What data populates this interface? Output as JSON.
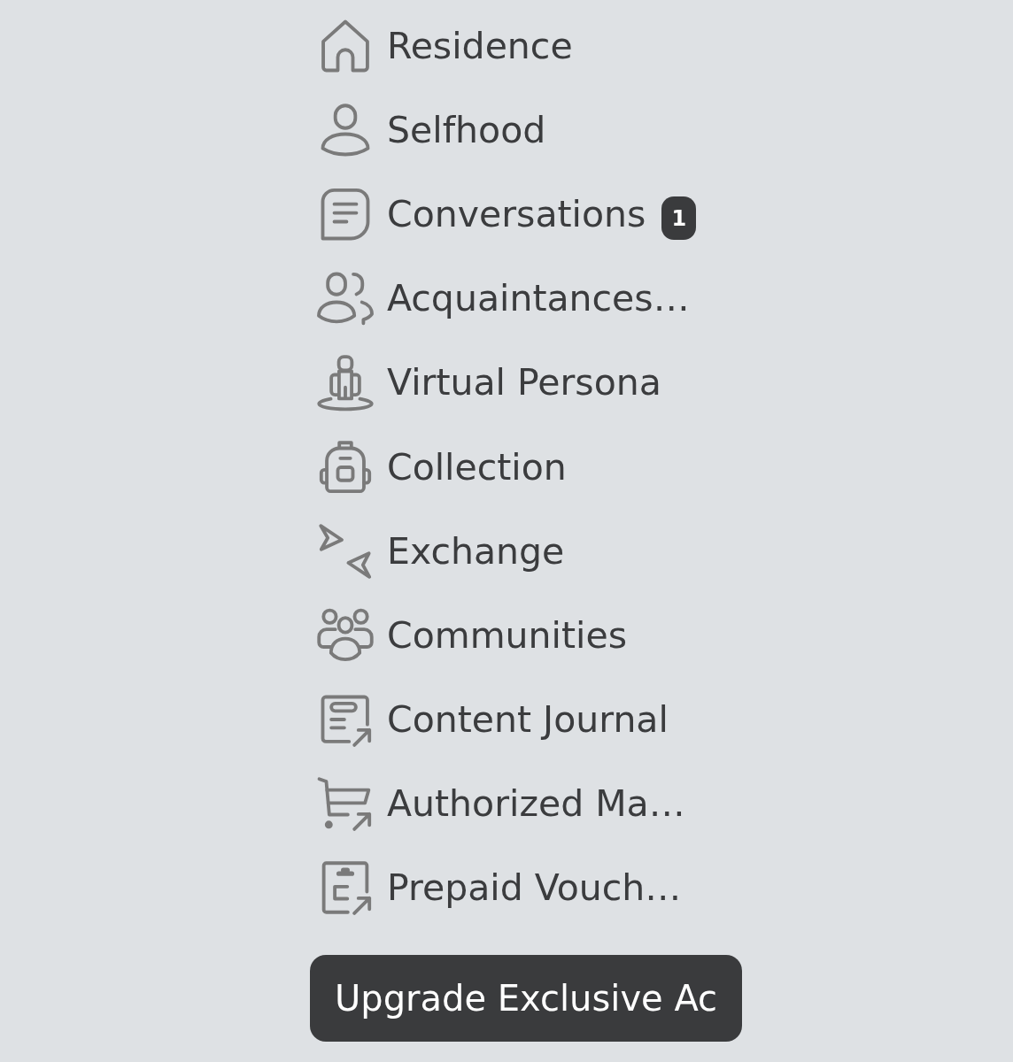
{
  "sidebar": {
    "items": [
      {
        "label": "Residence",
        "selected": false
      },
      {
        "label": "Selfhood",
        "selected": false
      },
      {
        "label": "Conversations",
        "selected": false,
        "badge": "1"
      },
      {
        "label": "Acquaintances…",
        "selected": false
      },
      {
        "label": "Virtual Persona",
        "selected": false
      },
      {
        "label": "Collection",
        "selected": false
      },
      {
        "label": "Exchange",
        "selected": false
      },
      {
        "label": "Communities",
        "selected": false
      },
      {
        "label": "Content Journal",
        "selected": false
      },
      {
        "label": "Authorized Ma…",
        "selected": false
      },
      {
        "label": "Prepaid Vouch…",
        "selected": false
      }
    ]
  },
  "upgrade_button": {
    "label": "Upgrade Exclusive Ac"
  }
}
